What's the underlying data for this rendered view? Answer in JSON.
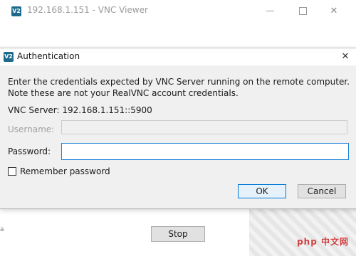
{
  "bg_window": {
    "icon_text": "V2",
    "title": "192.168.1.151 - VNC Viewer",
    "left_stub": "a",
    "stop_label": "Stop"
  },
  "dialog": {
    "icon_text": "V2",
    "title": "Authentication",
    "close_glyph": "✕",
    "message_line1": "Enter the credentials expected by VNC Server running on the remote computer.",
    "message_line2": "Note these are not your RealVNC account credentials.",
    "server_label": "VNC Server:",
    "server_value": "192.168.1.151::5900",
    "username_label": "Username:",
    "username_value": "",
    "password_label": "Password:",
    "password_value": "",
    "remember_label": "Remember password",
    "remember_checked": false,
    "ok_label": "OK",
    "cancel_label": "Cancel"
  },
  "window_controls": {
    "minimize_glyph": "",
    "maximize_glyph": "",
    "close_glyph": "✕"
  },
  "watermark": {
    "text": "php 中文网"
  },
  "colors": {
    "accent": "#0078d7",
    "app_icon": "#1e6a8d",
    "dialog_bg": "#f0f0f0"
  }
}
